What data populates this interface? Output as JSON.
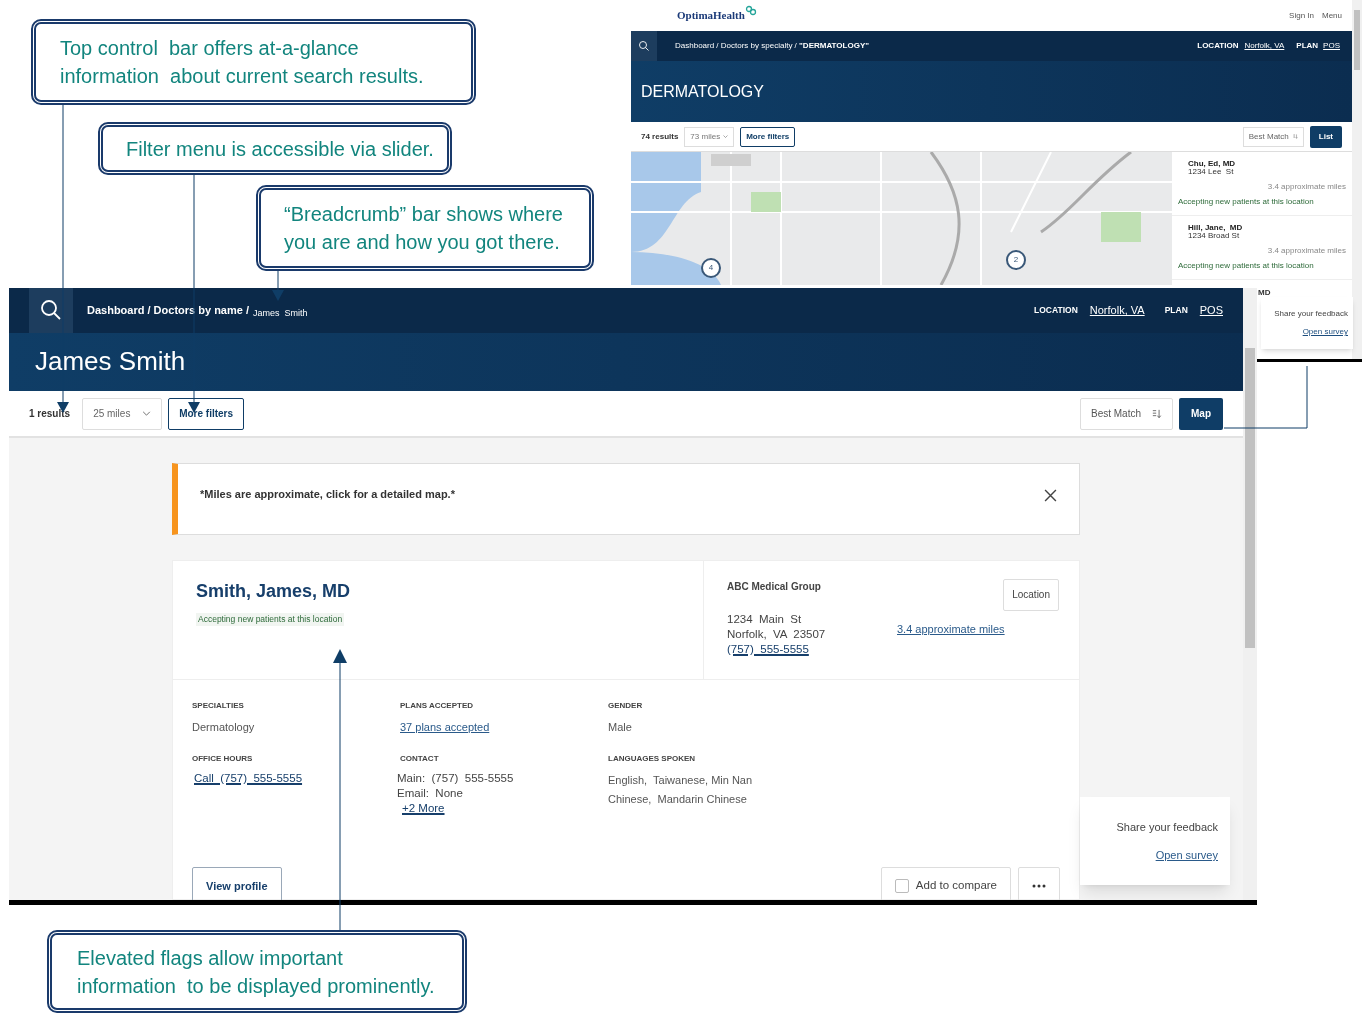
{
  "callouts": [
    {
      "kind": "top",
      "lines": [
        "Top control  bar offers at-a-glance",
        "information  about current search results."
      ]
    },
    {
      "kind": "filter",
      "lines": [
        "Filter menu is accessible via slider."
      ]
    },
    {
      "kind": "crumb",
      "lines": [
        "“Breadcrumb” bar shows where",
        "you are and how you got there."
      ]
    },
    {
      "kind": "flag",
      "lines": [
        "Elevated flags allow important",
        "information  to be displayed prominently."
      ]
    }
  ],
  "back_screen": {
    "logo": "OptimaHealth",
    "header_links": [
      "Sign In",
      "Menu"
    ],
    "breadcrumb": "Dashboard / Doctors by specialty / **\"DERMATOLOGY\"**",
    "location_label": "LOCATION",
    "location": "Norfolk, VA",
    "plan_label": "PLAN",
    "plan": "POS",
    "title": "DERMATOLOGY",
    "results": "74 results",
    "distance": "73 miles",
    "filters_button": "More filters",
    "sort": "Best Match",
    "view_button": "List",
    "map_markers": [
      "4",
      "2"
    ],
    "doctors": [
      {
        "name": "Chu, Ed, MD",
        "address": "1234 Lee  St",
        "distance": "3.4 approximate miles",
        "flag": "Accepting new patients at this location"
      },
      {
        "name": "Hill, Jane,  MD",
        "address": "1234 Broad St",
        "distance": "3.4 approximate miles",
        "flag": "Accepting new patients at this location"
      }
    ],
    "partial_item": "MD",
    "feedback": {
      "text": "Share your feedback",
      "link": "Open survey"
    }
  },
  "front_screen": {
    "breadcrumb": "Dashboard / Doctors by name /",
    "current": "James  Smith",
    "location_label": "LOCATION",
    "location": "Norfolk, VA",
    "plan_label": "PLAN",
    "plan": "POS",
    "title": "James Smith",
    "results": "1 results",
    "distance": "25 miles",
    "filters_button": "More filters",
    "sort": "Best Match",
    "view_button": "Map",
    "notice": "*Miles are approximate, click for a detailed map.*",
    "card": {
      "name": "Smith, James, MD",
      "flag": "Accepting new patients at this location",
      "group": "ABC Medical Group",
      "address_lines": [
        "1234  Main  St",
        "Norfolk,  VA  23507"
      ],
      "phone": "(757)  555-5555",
      "location_button": "Location",
      "distance_link": "3.4 approximate miles",
      "fields": [
        {
          "label": "SPECIALTIES",
          "lines": [
            {
              "kind": "text",
              "text": "Dermatology"
            }
          ]
        },
        {
          "label": "PLANS ACCEPTED",
          "lines": [
            {
              "kind": "link",
              "text": "37 plans accepted"
            }
          ]
        },
        {
          "label": "GENDER",
          "lines": [
            {
              "kind": "text",
              "text": "Male"
            }
          ]
        },
        {
          "label": "OFFICE HOURS",
          "lines": [
            {
              "kind": "phone",
              "text": "Call  (757)  555-5555"
            }
          ]
        },
        {
          "label": "CONTACT",
          "lines": [
            {
              "kind": "plain",
              "text": "Main:  (757)  555-5555"
            },
            {
              "kind": "plain",
              "text": "Email:  None"
            },
            {
              "kind": "phone",
              "text": "+2 More"
            }
          ]
        },
        {
          "label": "LANGUAGES SPOKEN",
          "lines": [
            {
              "kind": "text",
              "text": "English,  Taiwanese, Min Nan"
            },
            {
              "kind": "text",
              "text": "Chinese,  Mandarin Chinese"
            }
          ]
        }
      ],
      "view_profile": "View profile",
      "compare": {
        "label": "Add to compare",
        "checked": false
      }
    },
    "feedback": {
      "text": "Share your feedback",
      "link": "Open survey"
    }
  }
}
